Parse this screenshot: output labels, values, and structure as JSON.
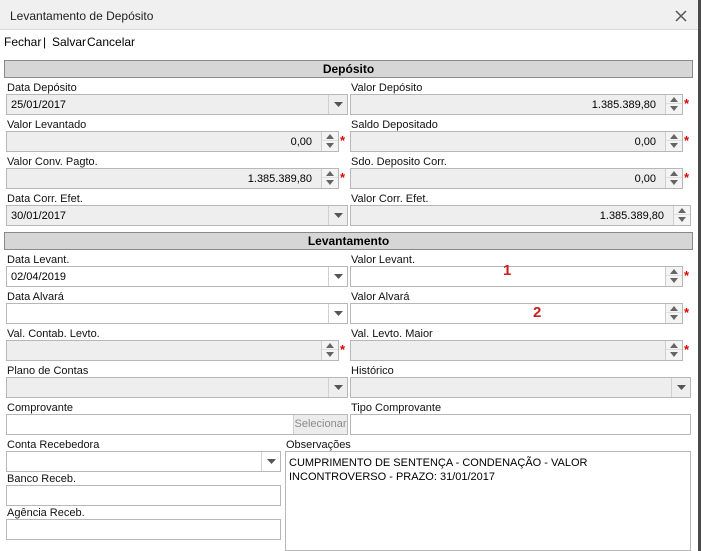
{
  "window": {
    "title": "Levantamento de Depósito"
  },
  "menu": {
    "fechar": "Fechar",
    "sep": "|",
    "salvar": "Salvar",
    "cancelar": "Cancelar"
  },
  "sections": {
    "deposito": "Depósito",
    "levantamento": "Levantamento"
  },
  "deposito": {
    "data_deposito_label": "Data Depósito",
    "data_deposito": "25/01/2017",
    "valor_deposito_label": "Valor Depósito",
    "valor_deposito": "1.385.389,80",
    "valor_levantado_label": "Valor Levantado",
    "valor_levantado": "0,00",
    "saldo_depositado_label": "Saldo Depositado",
    "saldo_depositado": "0,00",
    "valor_conv_label": "Valor Conv. Pagto.",
    "valor_conv": "1.385.389,80",
    "sdo_deposito_corr_label": "Sdo. Deposito Corr.",
    "sdo_deposito_corr": "0,00",
    "data_corr_label": "Data Corr. Efet.",
    "data_corr": "30/01/2017",
    "valor_corr_label": "Valor Corr. Efet.",
    "valor_corr": "1.385.389,80"
  },
  "levantamento": {
    "data_levant_label": "Data Levant.",
    "data_levant": "02/04/2019",
    "valor_levant_label": "Valor Levant.",
    "valor_levant": "",
    "data_alvara_label": "Data Alvará",
    "data_alvara": "",
    "valor_alvara_label": "Valor Alvará",
    "valor_alvara": "",
    "val_contab_label": "Val. Contab. Levto.",
    "val_contab": "",
    "val_levto_maior_label": "Val. Levto. Maior",
    "val_levto_maior": "",
    "plano_contas_label": "Plano de Contas",
    "historico_label": "Histórico",
    "comprovante_label": "Comprovante",
    "selecionar": "Selecionar",
    "tipo_comprovante_label": "Tipo Comprovante",
    "conta_recebedora_label": "Conta Recebedora",
    "observacoes_label": "Observações",
    "observacoes": "CUMPRIMENTO DE SENTENÇA - CONDENAÇÃO - VALOR INCONTROVERSO - PRAZO: 31/01/2017",
    "banco_receb_label": "Banco Receb.",
    "agencia_receb_label": "Agência Receb."
  },
  "annotations": {
    "one": "1",
    "two": "2"
  },
  "required_mark": "*",
  "colors": {
    "required": "#e00000",
    "annotation": "#c81e1e",
    "section_bg": "#d6d6d6"
  },
  "icons": {
    "close": "close-icon",
    "dropdown": "chevron-down-icon",
    "spin_up": "spin-up-icon",
    "spin_down": "spin-down-icon"
  }
}
